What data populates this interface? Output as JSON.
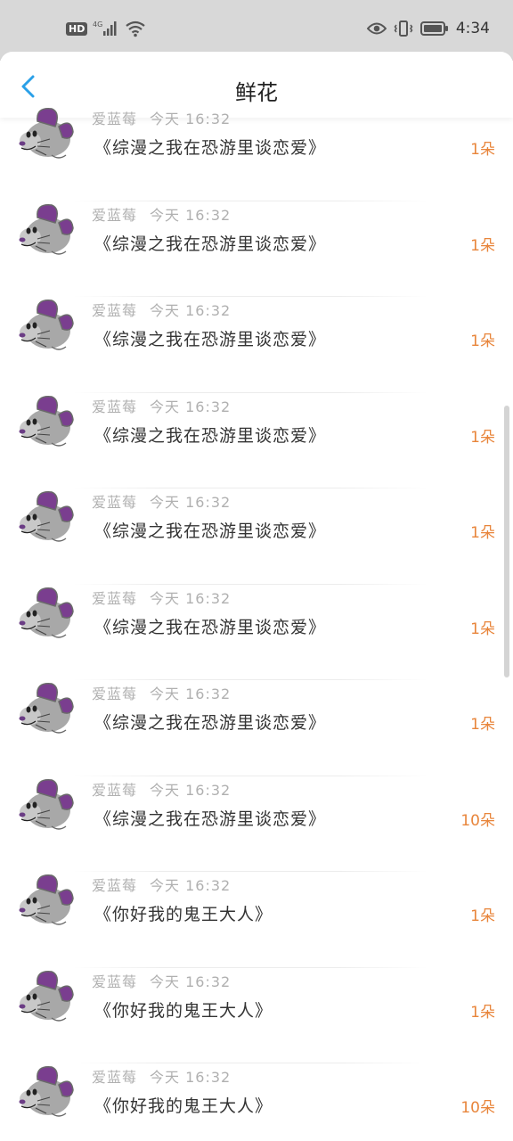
{
  "status_bar": {
    "hd_label": "HD",
    "network_label": "4G",
    "time": "4:34"
  },
  "header": {
    "title": "鲜花"
  },
  "accent_color": "#e8853b",
  "items": [
    {
      "user": "爱蓝莓",
      "time": "今天 16:32",
      "book": "《综漫之我在恐游里谈恋爱》",
      "count": "1朵"
    },
    {
      "user": "爱蓝莓",
      "time": "今天 16:32",
      "book": "《综漫之我在恐游里谈恋爱》",
      "count": "1朵"
    },
    {
      "user": "爱蓝莓",
      "time": "今天 16:32",
      "book": "《综漫之我在恐游里谈恋爱》",
      "count": "1朵"
    },
    {
      "user": "爱蓝莓",
      "time": "今天 16:32",
      "book": "《综漫之我在恐游里谈恋爱》",
      "count": "1朵"
    },
    {
      "user": "爱蓝莓",
      "time": "今天 16:32",
      "book": "《综漫之我在恐游里谈恋爱》",
      "count": "1朵"
    },
    {
      "user": "爱蓝莓",
      "time": "今天 16:32",
      "book": "《综漫之我在恐游里谈恋爱》",
      "count": "1朵"
    },
    {
      "user": "爱蓝莓",
      "time": "今天 16:32",
      "book": "《综漫之我在恐游里谈恋爱》",
      "count": "1朵"
    },
    {
      "user": "爱蓝莓",
      "time": "今天 16:32",
      "book": "《综漫之我在恐游里谈恋爱》",
      "count": "10朵"
    },
    {
      "user": "爱蓝莓",
      "time": "今天 16:32",
      "book": "《你好我的鬼王大人》",
      "count": "1朵"
    },
    {
      "user": "爱蓝莓",
      "time": "今天 16:32",
      "book": "《你好我的鬼王大人》",
      "count": "1朵"
    },
    {
      "user": "爱蓝莓",
      "time": "今天 16:32",
      "book": "《你好我的鬼王大人》",
      "count": "10朵"
    }
  ]
}
